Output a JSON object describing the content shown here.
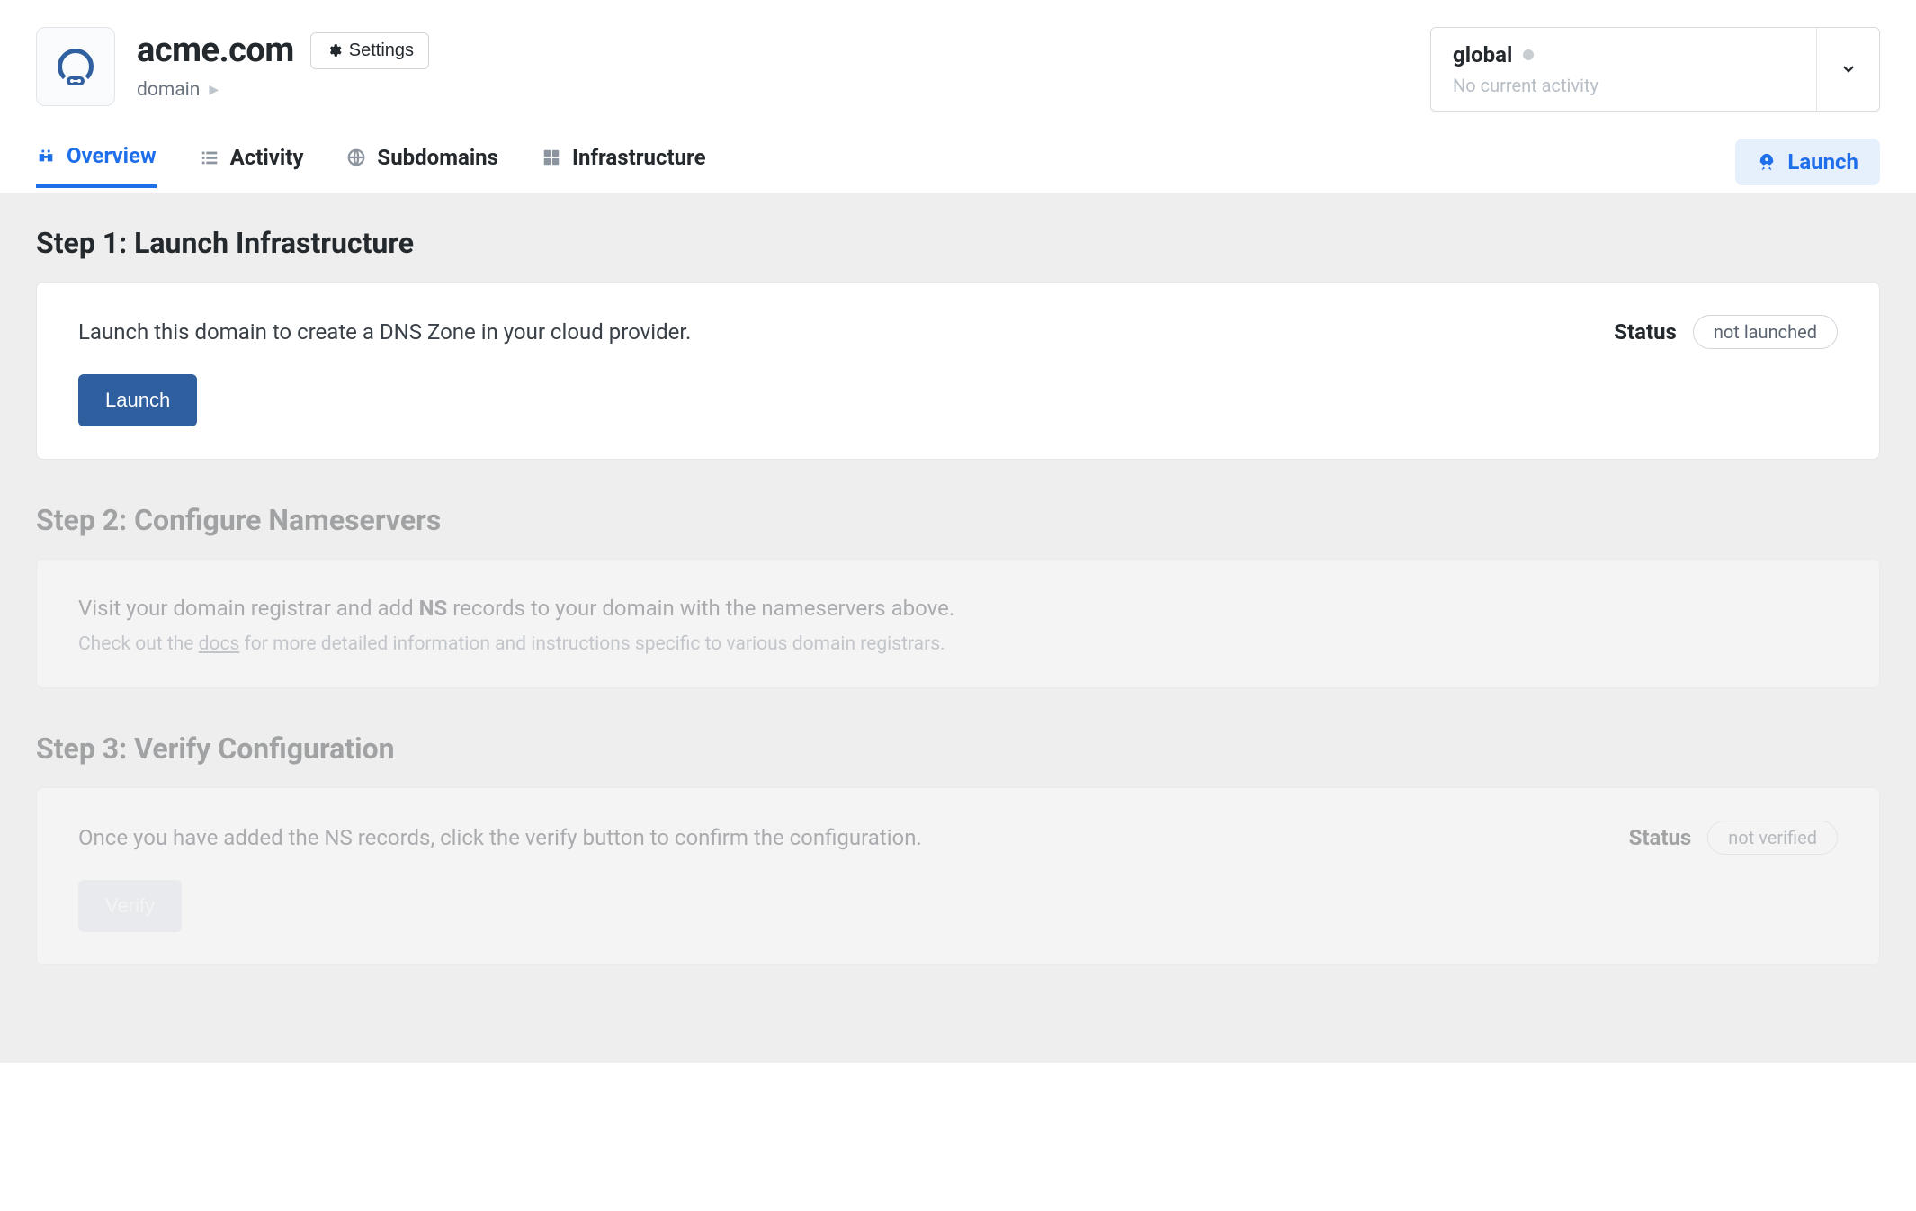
{
  "header": {
    "title": "acme.com",
    "settings_label": "Settings",
    "breadcrumb_label": "domain"
  },
  "environment": {
    "name": "global",
    "activity_text": "No current activity"
  },
  "tabs": {
    "overview": "Overview",
    "activity": "Activity",
    "subdomains": "Subdomains",
    "infrastructure": "Infrastructure"
  },
  "actions": {
    "launch": "Launch"
  },
  "steps": {
    "s1": {
      "title": "Step 1: Launch Infrastructure",
      "text": "Launch this domain to create a DNS Zone in your cloud provider.",
      "status_label": "Status",
      "status_value": "not launched",
      "button": "Launch"
    },
    "s2": {
      "title": "Step 2: Configure Nameservers",
      "text_pre": "Visit your domain registrar and add ",
      "text_bold": "NS",
      "text_post": " records to your domain with the nameservers above.",
      "subtext_pre": "Check out the ",
      "subtext_link": "docs",
      "subtext_post": " for more detailed information and instructions specific to various domain registrars."
    },
    "s3": {
      "title": "Step 3: Verify Configuration",
      "text": "Once you have added the NS records, click the verify button to confirm the configuration.",
      "status_label": "Status",
      "status_value": "not verified",
      "button": "Verify"
    }
  }
}
